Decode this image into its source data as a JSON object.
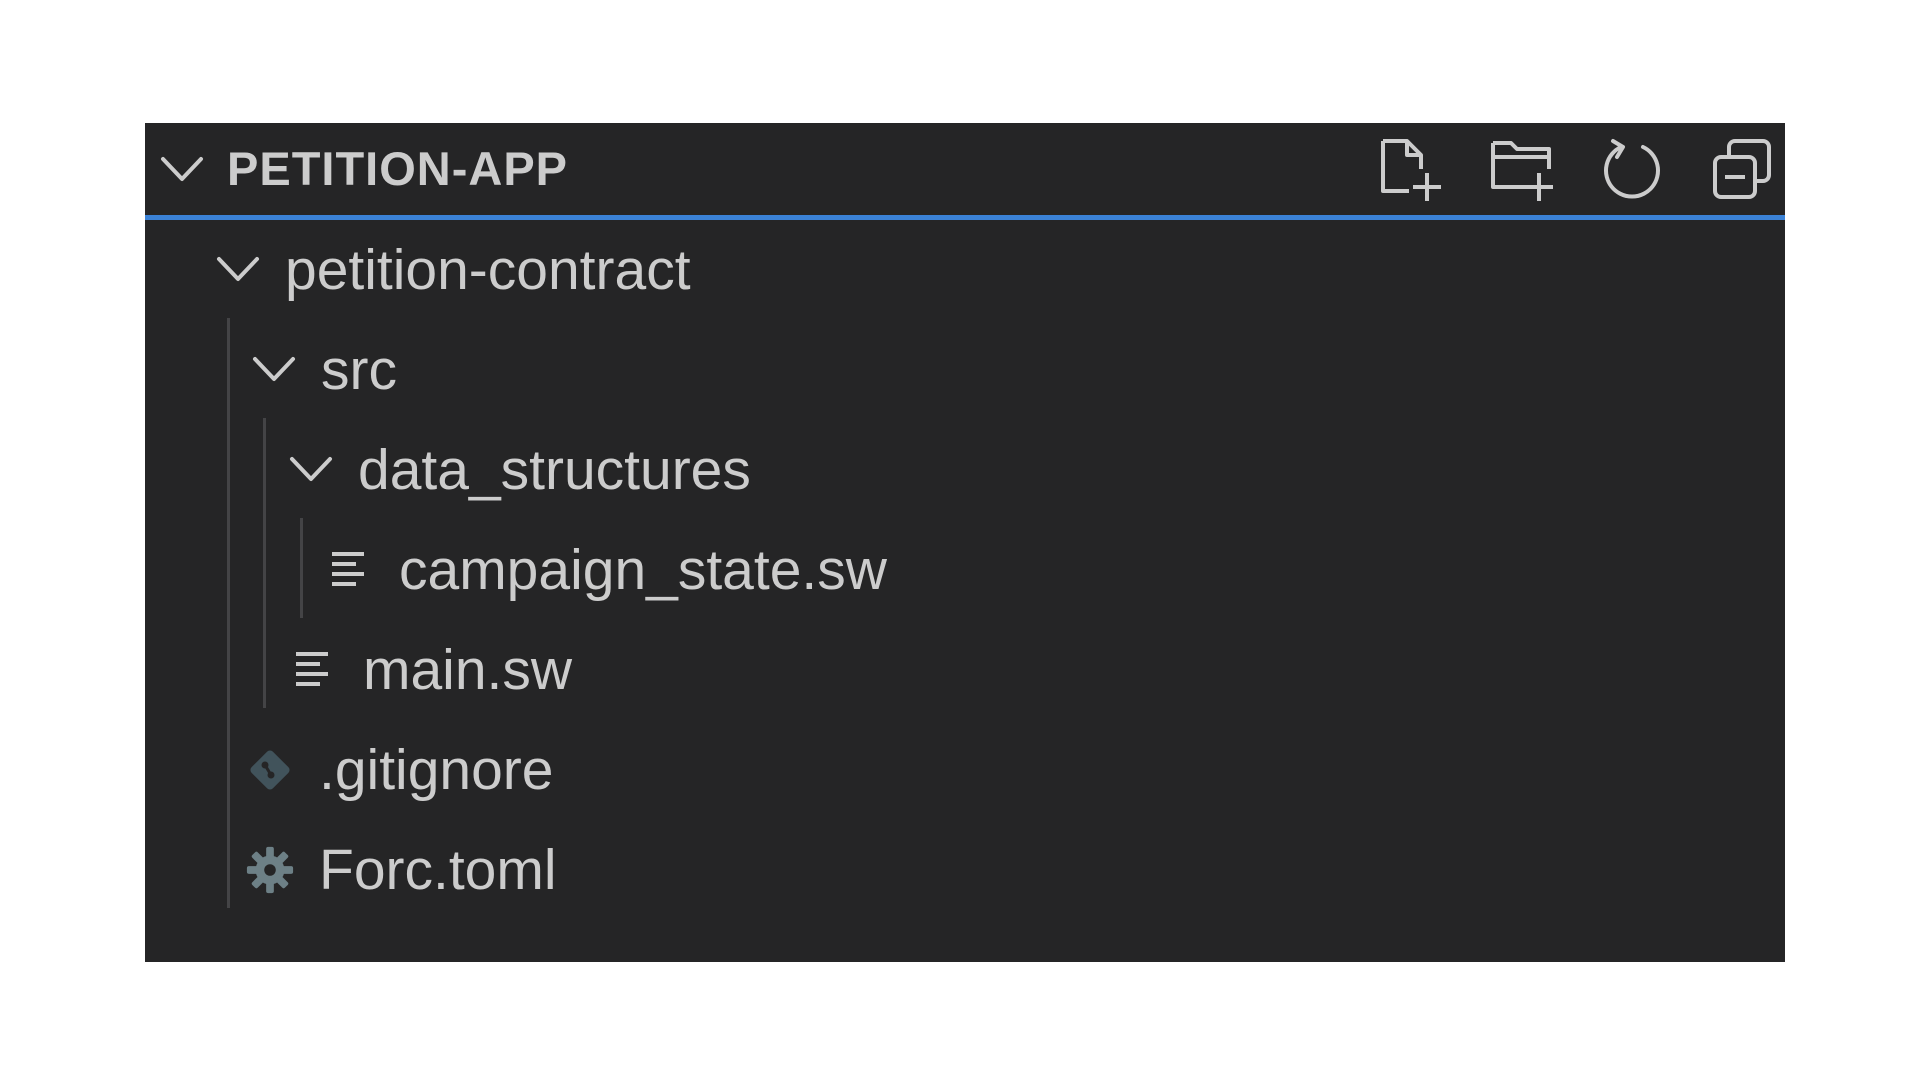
{
  "explorer": {
    "title": "PETITION-APP",
    "accent_color": "#3b82d6",
    "actions": [
      {
        "name": "new-file-icon"
      },
      {
        "name": "new-folder-icon"
      },
      {
        "name": "refresh-icon"
      },
      {
        "name": "collapse-all-icon"
      }
    ]
  },
  "tree": [
    {
      "label": "petition-contract",
      "kind": "folder",
      "expanded": true,
      "depth": 1
    },
    {
      "label": "src",
      "kind": "folder",
      "expanded": true,
      "depth": 2
    },
    {
      "label": "data_structures",
      "kind": "folder",
      "expanded": true,
      "depth": 3
    },
    {
      "label": "campaign_state.sw",
      "kind": "file",
      "icon": "text-file-icon",
      "depth": 4
    },
    {
      "label": "main.sw",
      "kind": "file",
      "icon": "text-file-icon",
      "depth": 3
    },
    {
      "label": ".gitignore",
      "kind": "file",
      "icon": "git-icon",
      "depth": 2
    },
    {
      "label": "Forc.toml",
      "kind": "file",
      "icon": "gear-icon",
      "depth": 2
    }
  ]
}
